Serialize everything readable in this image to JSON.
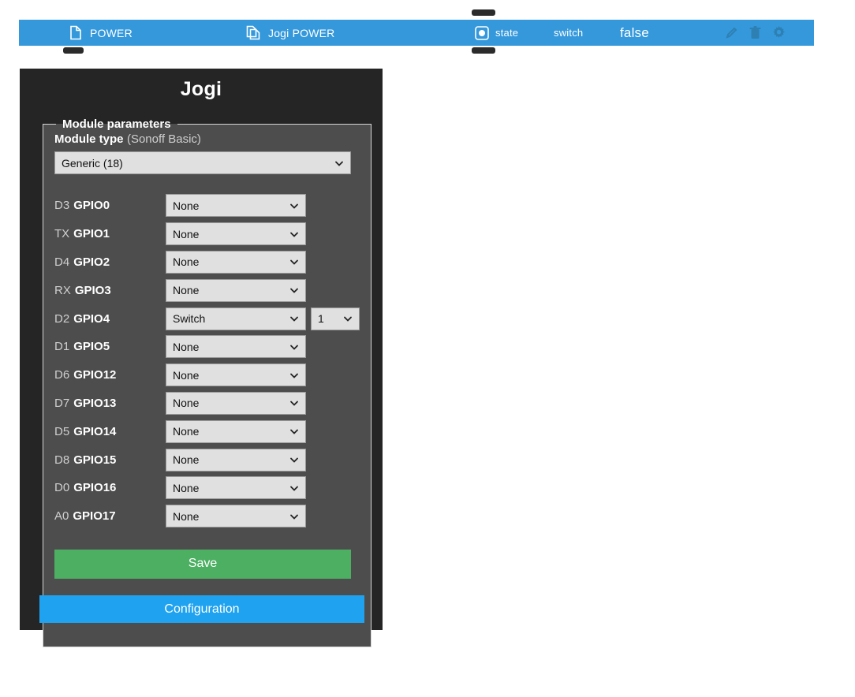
{
  "top_bar": {
    "background_color": "#3498db",
    "device_label": "POWER",
    "device_icon": "file-icon",
    "topic_label": "Jogi POWER",
    "topic_icon": "copy-icon",
    "state_icon": "radio-button-icon",
    "state_label": "state",
    "type_label": "switch",
    "value_label": "false",
    "actions": [
      {
        "name": "edit-icon",
        "title": "Edit"
      },
      {
        "name": "delete-icon",
        "title": "Delete"
      },
      {
        "name": "gear-icon",
        "title": "Settings"
      }
    ]
  },
  "panel": {
    "title": "Jogi",
    "background_color": "#252525",
    "fieldset_legend": "Module parameters",
    "fieldset_background_color": "#4d4d4d",
    "module_type": {
      "label": "Module type",
      "hint": "(Sonoff Basic)",
      "selected": "Generic (18)"
    },
    "gpio_rows": [
      {
        "pin": "D3",
        "gpio": "GPIO0",
        "value": "None"
      },
      {
        "pin": "TX",
        "gpio": "GPIO1",
        "value": "None"
      },
      {
        "pin": "D4",
        "gpio": "GPIO2",
        "value": "None"
      },
      {
        "pin": "RX",
        "gpio": "GPIO3",
        "value": "None"
      },
      {
        "pin": "D2",
        "gpio": "GPIO4",
        "value": "Switch",
        "index": "1"
      },
      {
        "pin": "D1",
        "gpio": "GPIO5",
        "value": "None"
      },
      {
        "pin": "D6",
        "gpio": "GPIO12",
        "value": "None"
      },
      {
        "pin": "D7",
        "gpio": "GPIO13",
        "value": "None"
      },
      {
        "pin": "D5",
        "gpio": "GPIO14",
        "value": "None"
      },
      {
        "pin": "D8",
        "gpio": "GPIO15",
        "value": "None"
      },
      {
        "pin": "D0",
        "gpio": "GPIO16",
        "value": "None"
      },
      {
        "pin": "A0",
        "gpio": "GPIO17",
        "value": "None"
      }
    ],
    "save_label": "Save",
    "save_color": "#4caf62",
    "configuration_label": "Configuration",
    "configuration_color": "#1fa2ef"
  }
}
